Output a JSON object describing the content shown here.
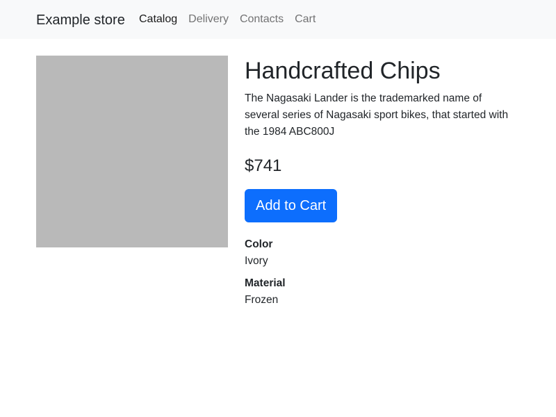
{
  "navbar": {
    "brand": "Example store",
    "links": [
      {
        "label": "Catalog",
        "active": true
      },
      {
        "label": "Delivery",
        "active": false
      },
      {
        "label": "Contacts",
        "active": false
      },
      {
        "label": "Cart",
        "active": false
      }
    ],
    "background_color": "#f8f9fa"
  },
  "product": {
    "image_placeholder_color": "#b9b9b9",
    "title": "Handcrafted Chips",
    "description": "The Nagasaki Lander is the trademarked name of several series of Nagasaki sport bikes, that started with the 1984 ABC800J",
    "price": "$741",
    "add_to_cart_label": "Add to Cart",
    "button_color": "#0d6efd",
    "attributes": [
      {
        "label": "Color",
        "value": "Ivory"
      },
      {
        "label": "Material",
        "value": "Frozen"
      }
    ]
  }
}
